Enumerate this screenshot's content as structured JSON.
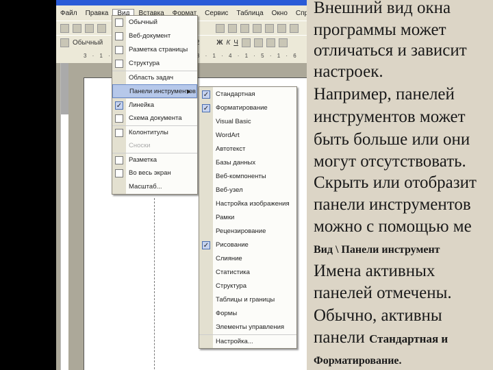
{
  "menubar": [
    "Файл",
    "Правка",
    "Вид",
    "Вставка",
    "Формат",
    "Сервис",
    "Таблица",
    "Окно",
    "Справка"
  ],
  "toolbar": {
    "style": "Обычный",
    "size": "12",
    "bold": "Ж",
    "italic": "К",
    "underline": "Ч"
  },
  "ruler": "3 · 1 · 2 · 1 · 1 · 2 · 1 · 3 · 1 · 4 · 1 · 5 · 1 · 6",
  "view_menu": [
    {
      "label": "Обычный",
      "icon": "normal-view-icon"
    },
    {
      "label": "Веб-документ",
      "icon": "web-view-icon"
    },
    {
      "label": "Разметка страницы",
      "icon": "page-layout-icon"
    },
    {
      "label": "Структура",
      "icon": "outline-icon"
    },
    {
      "label": "Область задач",
      "icon": ""
    },
    {
      "label": "Панели инструментов",
      "icon": "",
      "submenu": true,
      "highlighted": true
    },
    {
      "label": "Линейка",
      "icon": "check-icon",
      "checked": true
    },
    {
      "label": "Схема документа",
      "icon": "document-map-icon"
    },
    {
      "label": "Колонтитулы",
      "icon": "header-footer-icon"
    },
    {
      "label": "Сноски",
      "icon": "",
      "disabled": true
    },
    {
      "label": "Разметка",
      "icon": "markup-icon"
    },
    {
      "label": "Во весь экран",
      "icon": "full-screen-icon"
    },
    {
      "label": "Масштаб...",
      "icon": ""
    }
  ],
  "toolbars_submenu": [
    {
      "label": "Стандартная",
      "checked": true
    },
    {
      "label": "Форматирование",
      "checked": true
    },
    {
      "label": "Visual Basic"
    },
    {
      "label": "WordArt"
    },
    {
      "label": "Автотекст"
    },
    {
      "label": "Базы данных"
    },
    {
      "label": "Веб-компоненты"
    },
    {
      "label": "Веб-узел"
    },
    {
      "label": "Настройка изображения"
    },
    {
      "label": "Рамки"
    },
    {
      "label": "Рецензирование"
    },
    {
      "label": "Рисование",
      "checked": true
    },
    {
      "label": "Слияние"
    },
    {
      "label": "Статистика"
    },
    {
      "label": "Структура"
    },
    {
      "label": "Таблицы и границы"
    },
    {
      "label": "Формы"
    },
    {
      "label": "Элементы управления"
    },
    {
      "label": "Настройка...",
      "separator": true
    }
  ],
  "text": {
    "l1": "Внешний вид окна",
    "l2": "программы может",
    "l3": "отличаться и зависит",
    "l4": "настроек.",
    "l5": "Например, панелей",
    "l6": "инструментов может",
    "l7": "быть больше или они",
    "l8": "могут отсутствовать.",
    "l9": "Скрыть или отобразит",
    "l10": "панели инструментов",
    "l11": "можно с помощью ме",
    "l12": "Вид \\ Панели инструмент",
    "l13": "Имена активных",
    "l14": "панелей отмечены.",
    "l15": "Обычно, активны",
    "l16a": "панели ",
    "l16b": "Стандартная и",
    "l17": "Форматирование."
  }
}
